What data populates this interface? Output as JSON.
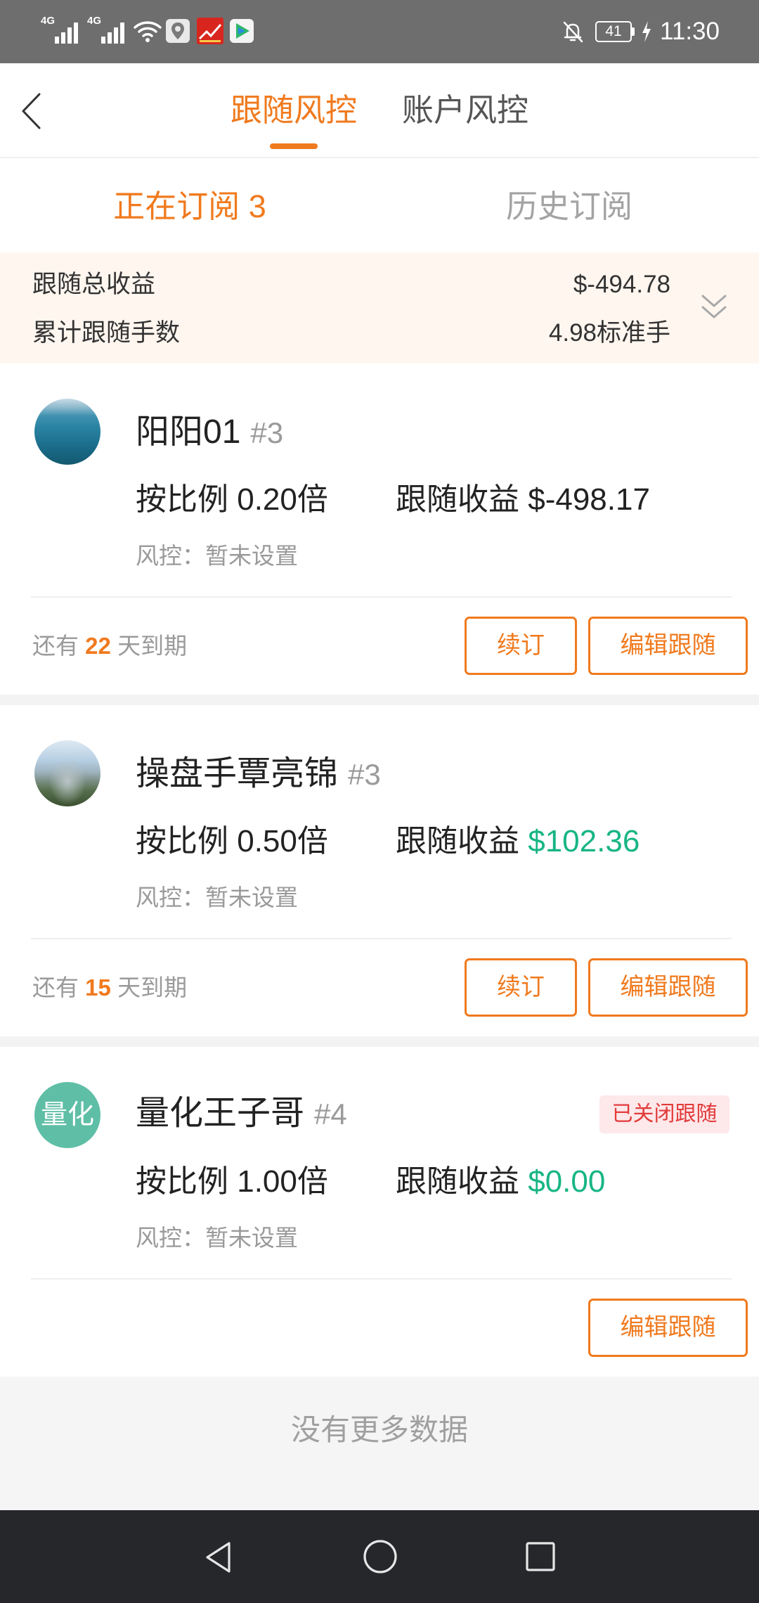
{
  "status_bar": {
    "network_1": "4G",
    "network_2": "4G",
    "battery_level": "41",
    "time": "11:30",
    "icons": [
      "signal-icon",
      "signal-icon",
      "wifi-icon",
      "map-app-icon",
      "news-app-icon",
      "video-app-icon",
      "bell-off-icon",
      "battery-icon",
      "charging-icon"
    ]
  },
  "header": {
    "back_icon": "chevron-left-icon",
    "tabs": [
      {
        "label": "跟随风控"
      },
      {
        "label": "账户风控"
      }
    ]
  },
  "subtabs": [
    {
      "label": "正在订阅 3"
    },
    {
      "label": "历史订阅"
    }
  ],
  "summary": {
    "total_profit_label": "跟随总收益",
    "total_profit_value": "$-494.78",
    "total_lots_label": "累计跟随手数",
    "total_lots_value": "4.98标准手",
    "expand_icon": "double-chevron-down-icon"
  },
  "cards": [
    {
      "name": "阳阳01",
      "tag": "#3",
      "ratio_label": "按比例",
      "ratio_value": "0.20倍",
      "profit_label": "跟随收益",
      "profit_value": "$-498.17",
      "profit_color": "#222222",
      "risk_label": "风控：",
      "risk_value": "暂未设置",
      "expire_prefix": "还有",
      "days_left": "22",
      "expire_suffix": "天到期",
      "renew_label": "续订",
      "edit_label": "编辑跟随"
    },
    {
      "name": "操盘手覃亮锦",
      "tag": "#3",
      "ratio_label": "按比例",
      "ratio_value": "0.50倍",
      "profit_label": "跟随收益",
      "profit_value": "$102.36",
      "profit_color": "#17b584",
      "risk_label": "风控：",
      "risk_value": "暂未设置",
      "expire_prefix": "还有",
      "days_left": "15",
      "expire_suffix": "天到期",
      "renew_label": "续订",
      "edit_label": "编辑跟随"
    },
    {
      "name": "量化王子哥",
      "tag": "#4",
      "avatar_text": "量化",
      "avatar_color": "#5fbea6",
      "status_badge": "已关闭跟随",
      "ratio_label": "按比例",
      "ratio_value": "1.00倍",
      "profit_label": "跟随收益",
      "profit_value": "$0.00",
      "profit_color": "#17b584",
      "risk_label": "风控：",
      "risk_value": "暂未设置",
      "edit_label": "编辑跟随"
    }
  ],
  "footer": {
    "no_more_text": "没有更多数据"
  },
  "colors": {
    "accent": "#f07a1e",
    "positive": "#17b584",
    "badge_background": "#fde8ea",
    "badge_text": "#e23b3b"
  }
}
